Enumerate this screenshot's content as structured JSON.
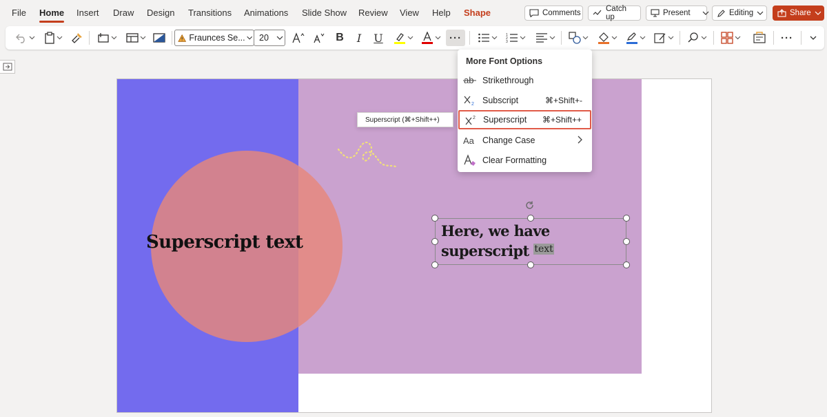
{
  "tabs": {
    "file": "File",
    "home": "Home",
    "insert": "Insert",
    "draw": "Draw",
    "design": "Design",
    "transitions": "Transitions",
    "animations": "Animations",
    "slideshow": "Slide Show",
    "review": "Review",
    "view": "View",
    "help": "Help",
    "shape": "Shape"
  },
  "top_actions": {
    "comments": "Comments",
    "catchup": "Catch up",
    "present": "Present",
    "editing": "Editing",
    "share": "Share"
  },
  "ribbon": {
    "font_name": "Fraunces Se...",
    "font_size": "20",
    "bold": "B",
    "italic": "I",
    "underline": "U",
    "more": "···"
  },
  "menu": {
    "title": "More Font Options",
    "items": [
      {
        "icon": "strikethrough-icon",
        "label": "Strikethrough",
        "shortcut": ""
      },
      {
        "icon": "subscript-icon",
        "label": "Subscript",
        "shortcut": "⌘+Shift+-"
      },
      {
        "icon": "superscript-icon",
        "label": "Superscript",
        "shortcut": "⌘+Shift++"
      },
      {
        "icon": "change-case-icon",
        "label": "Change Case",
        "shortcut": ""
      },
      {
        "icon": "clear-formatting-icon",
        "label": "Clear Formatting",
        "shortcut": ""
      }
    ]
  },
  "tooltip": "Superscript (⌘+Shift++)",
  "slide": {
    "big_text": "Superscript text",
    "textbox_line1": "Here, we have",
    "textbox_line2": "superscript",
    "textbox_sup": "text"
  },
  "colors": {
    "accent": "#c43e1c",
    "blue_panel": "#736bee",
    "pink_panel": "#caa2cf",
    "circle": "#e7877a",
    "highlight_border": "#e05a47"
  }
}
